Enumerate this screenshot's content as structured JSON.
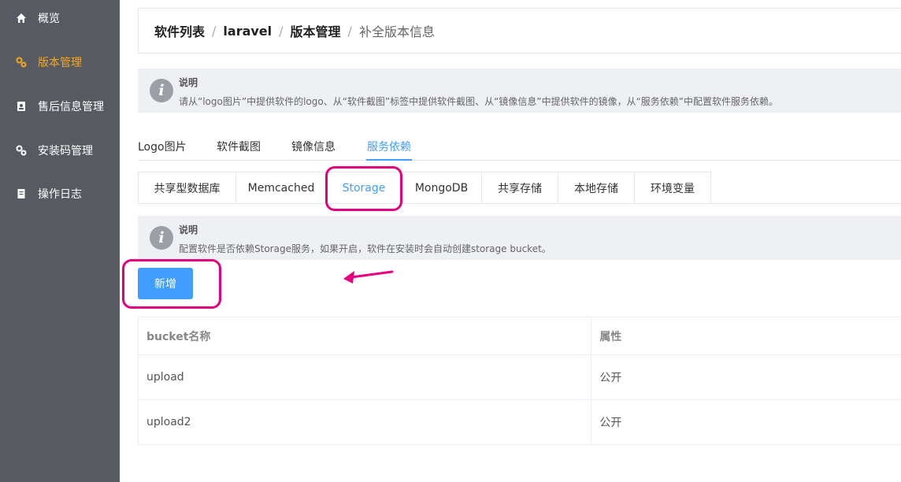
{
  "sidebar": {
    "items": [
      {
        "label": "概览",
        "icon": "home-icon"
      },
      {
        "label": "版本管理",
        "icon": "gears-icon",
        "active": true
      },
      {
        "label": "售后信息管理",
        "icon": "contact-card-icon"
      },
      {
        "label": "安装码管理",
        "icon": "gears-icon"
      },
      {
        "label": "操作日志",
        "icon": "document-icon"
      }
    ]
  },
  "breadcrumb": [
    "软件列表",
    "laravel",
    "版本管理",
    "补全版本信息"
  ],
  "notice_top": {
    "title": "说明",
    "text": "请从“logo图片”中提供软件的logo、从“软件截图”标签中提供软件截图、从“镜像信息”中提供软件的镜像，从“服务依赖”中配置软件服务依赖。"
  },
  "tabs": [
    "Logo图片",
    "软件截图",
    "镜像信息",
    "服务依赖"
  ],
  "active_tab": "服务依赖",
  "subtabs": [
    "共享型数据库",
    "Memcached",
    "Storage",
    "MongoDB",
    "共享存储",
    "本地存储",
    "环境变量"
  ],
  "active_subtab": "Storage",
  "notice_storage": {
    "title": "说明",
    "text": "配置软件是否依赖Storage服务，如果开启，软件在安装时会自动创建storage bucket。"
  },
  "add_button": "新增",
  "table": {
    "headers": [
      "bucket名称",
      "属性"
    ],
    "rows": [
      [
        "upload",
        "公开"
      ],
      [
        "upload2",
        "公开"
      ]
    ]
  },
  "colors": {
    "sidebar_bg": "#575b61",
    "active_nav": "#f5a623",
    "primary": "#409eff",
    "highlight": "#e4007f"
  }
}
